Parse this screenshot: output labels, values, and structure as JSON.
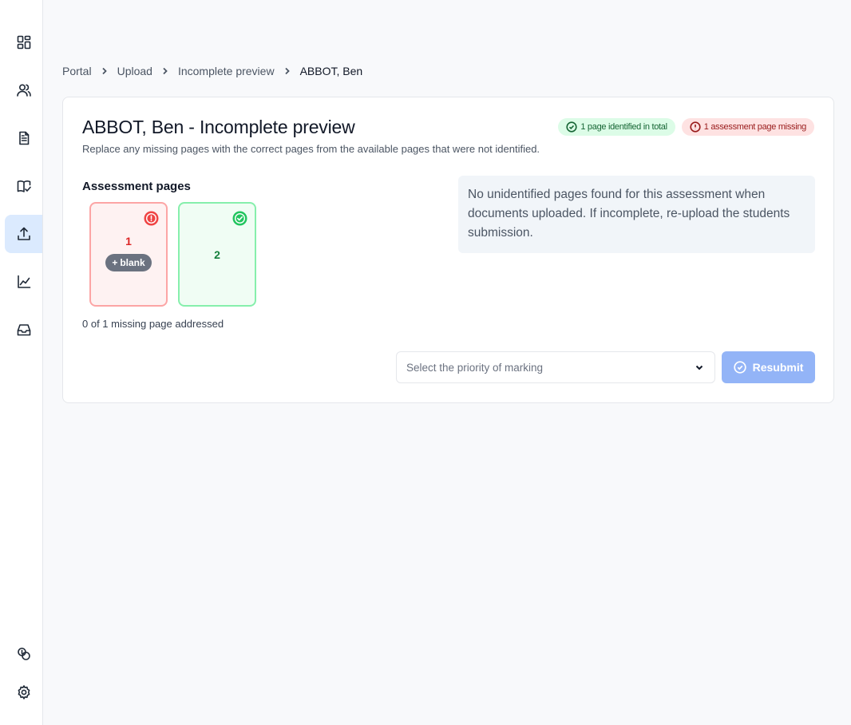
{
  "breadcrumb": [
    {
      "label": "Portal"
    },
    {
      "label": "Upload"
    },
    {
      "label": "Incomplete preview"
    }
  ],
  "breadcrumb_current": "ABBOT, Ben",
  "title": "ABBOT, Ben - Incomplete preview",
  "subtitle": "Replace any missing pages with the correct pages from the available pages that were not identified.",
  "badges": {
    "identified": "1 page identified in total",
    "missing": "1 assessment page missing"
  },
  "assessment": {
    "label": "Assessment pages",
    "pages": [
      {
        "number": "1",
        "status": "missing",
        "action_label": "blank"
      },
      {
        "number": "2",
        "status": "identified"
      }
    ],
    "status_text": "0 of 1 missing page addressed"
  },
  "info_message": "No unidentified pages found for this assessment when documents uploaded. If incomplete, re-upload the students submission.",
  "priority_select": {
    "placeholder": "Select the priority of marking"
  },
  "resubmit_label": "Resubmit",
  "sidebar": {
    "icons": [
      "dashboard-icon",
      "users-icon",
      "document-icon",
      "book-check-icon",
      "upload-icon",
      "chart-icon",
      "inbox-icon",
      "coins-icon",
      "settings-icon"
    ],
    "active": "upload-icon"
  },
  "colors": {
    "accent": "#93b4f7",
    "active_nav": "#dbeafe",
    "missing": "#dc2626",
    "identified": "#15803d"
  }
}
